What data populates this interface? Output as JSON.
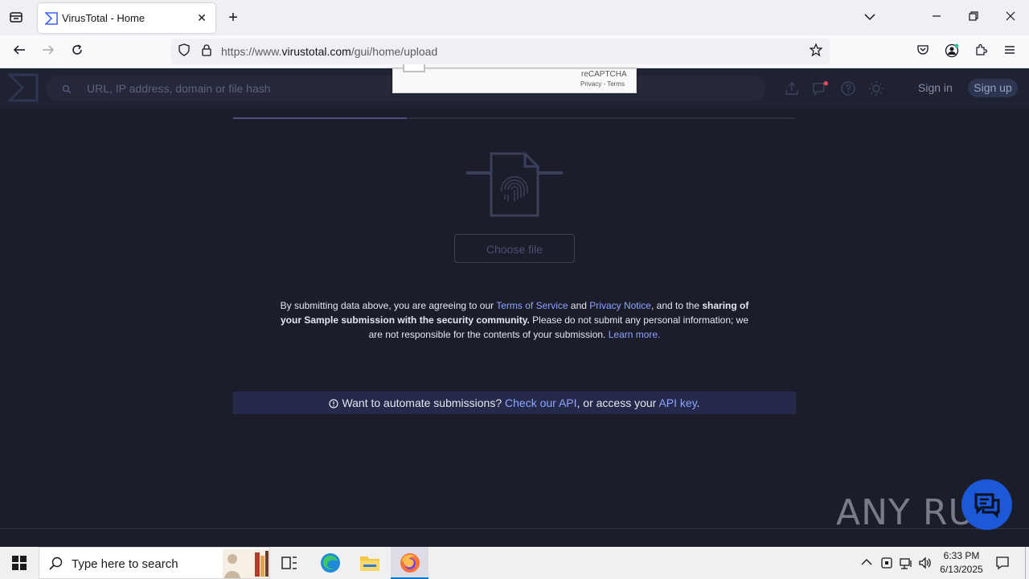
{
  "browser": {
    "tab_title": "VirusTotal - Home",
    "url_prefix": "https://www.",
    "url_host": "virustotal.com",
    "url_path": "/gui/home/upload"
  },
  "header": {
    "search_placeholder": "URL, IP address, domain or file hash",
    "sign_in": "Sign in",
    "sign_up": "Sign up"
  },
  "recaptcha": {
    "label": "reCAPTCHA",
    "links": "Privacy - Terms"
  },
  "upload": {
    "choose_file": "Choose file"
  },
  "terms": {
    "p1": "By submitting data above, you are agreeing to our ",
    "tos": "Terms of Service",
    "and": " and ",
    "privacy": "Privacy Notice",
    "p2": ", and to the ",
    "bold": "sharing of your Sample submission with the security community.",
    "p3": " Please do not submit any personal information; we are not responsible for the contents of your submission. ",
    "learn": "Learn more."
  },
  "api": {
    "text1": "Want to automate submissions? ",
    "link1": "Check our API",
    "text2": ", or access your ",
    "link2": "API key",
    "text3": "."
  },
  "watermark": "ANY RUN",
  "taskbar": {
    "search_placeholder": "Type here to search",
    "time": "6:33 PM",
    "date": "6/13/2025"
  },
  "colors": {
    "page_bg": "#1b1d2b",
    "header_bg": "#1f2232",
    "link": "#8ea4ff",
    "api_bar_bg": "#25294a"
  }
}
